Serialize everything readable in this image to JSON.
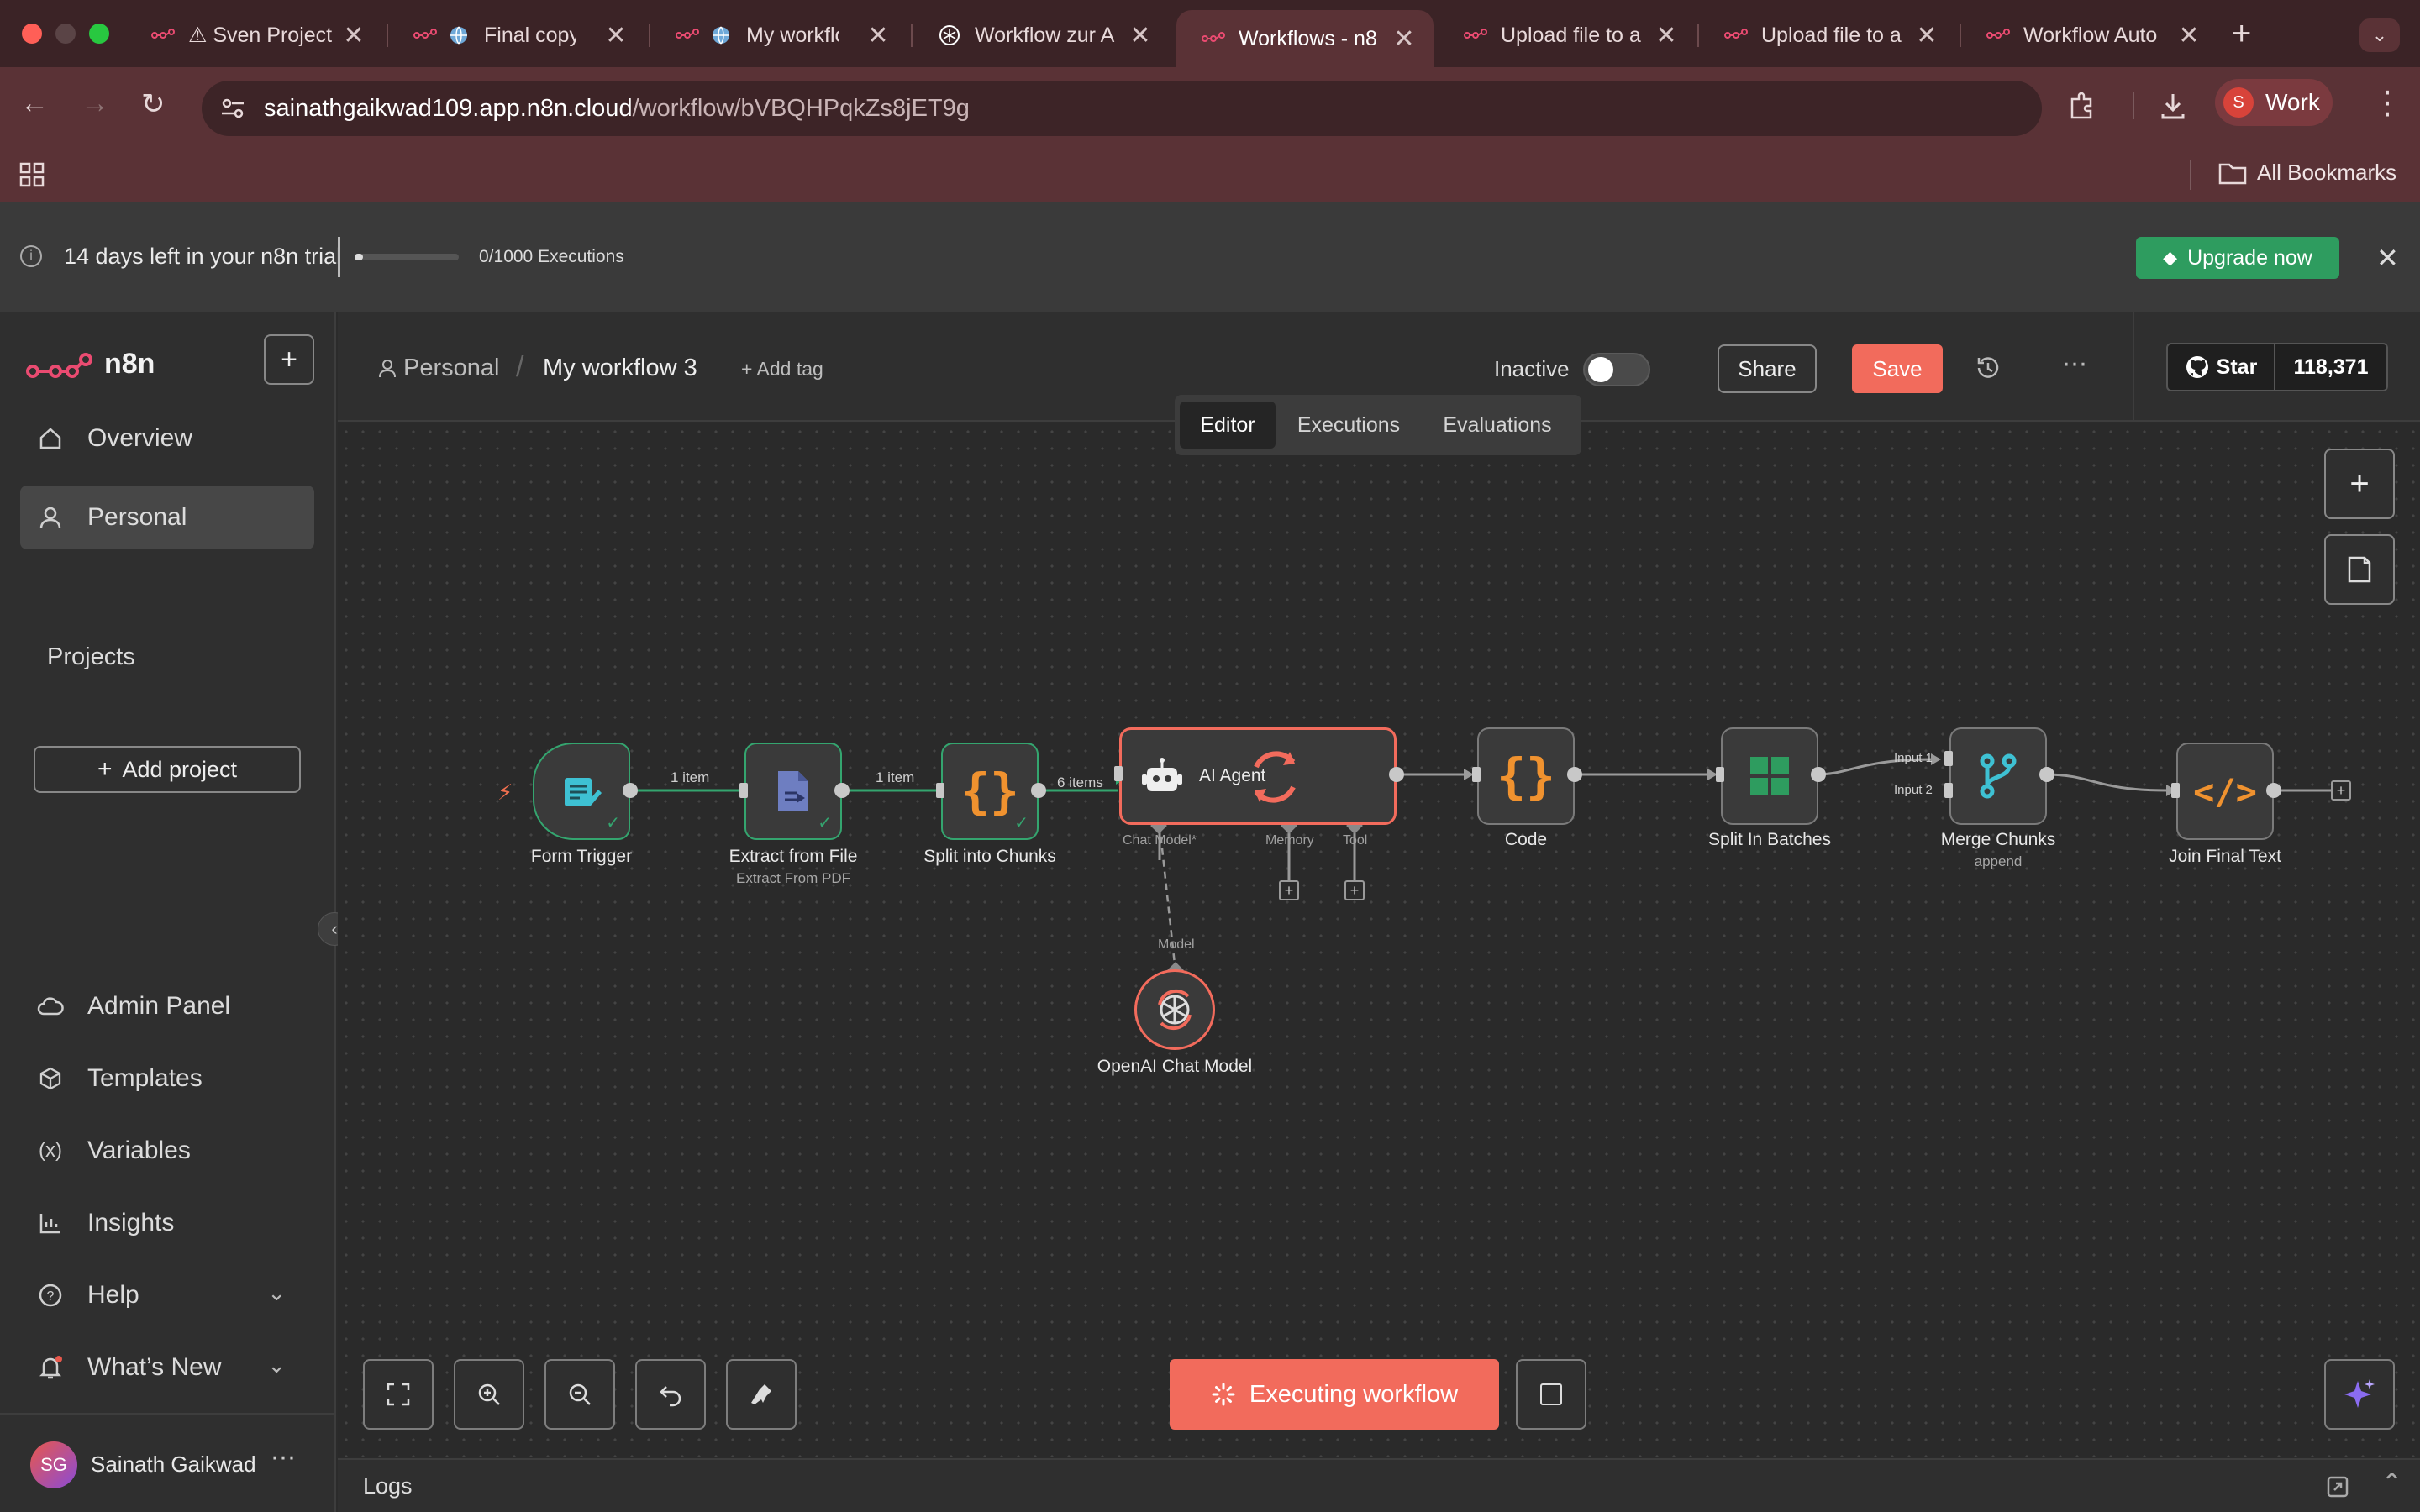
{
  "browser": {
    "tabs": [
      {
        "title": "⚠ Sven Project",
        "icon": "n8n-logo-icon"
      },
      {
        "title": "Final copy -",
        "icon": "globe-icon"
      },
      {
        "title": "My workflow",
        "icon": "globe-icon"
      },
      {
        "title": "Workflow zur A",
        "icon": "openai-icon"
      },
      {
        "title": "Workflows - n8",
        "icon": "n8n-logo-icon",
        "active": true
      },
      {
        "title": "Upload file to a",
        "icon": "n8n-logo-icon"
      },
      {
        "title": "Upload file to a",
        "icon": "n8n-logo-icon"
      },
      {
        "title": "Workflow Auto",
        "icon": "n8n-logo-icon"
      }
    ],
    "url_host": "sainathgaikwad109.app.n8n.cloud",
    "url_path": "/workflow/bVBQHPqkZs8jET9g",
    "profile_label": "Work",
    "profile_initial": "S",
    "bookmarks_label": "All Bookmarks"
  },
  "trial": {
    "text": "14 days left in your n8n trial",
    "executions": "0/1000 Executions",
    "progress_fraction": 0.0,
    "upgrade_label": "Upgrade now"
  },
  "sidebar": {
    "brand": "n8n",
    "items": [
      {
        "label": "Overview",
        "icon": "home-icon"
      },
      {
        "label": "Personal",
        "icon": "user-icon",
        "active": true
      }
    ],
    "projects_heading": "Projects",
    "add_project_label": "Add project",
    "bottom_items": [
      {
        "label": "Admin Panel",
        "icon": "cloud-icon"
      },
      {
        "label": "Templates",
        "icon": "templates-icon"
      },
      {
        "label": "Variables",
        "icon": "variables-icon"
      },
      {
        "label": "Insights",
        "icon": "chart-icon"
      },
      {
        "label": "Help",
        "icon": "help-icon"
      },
      {
        "label": "What’s New",
        "icon": "bell-icon"
      }
    ],
    "user_initials": "SG",
    "user_name": "Sainath Gaikwad"
  },
  "header": {
    "breadcrumb_project": "Personal",
    "workflow_name": "My workflow 3",
    "add_tag": "+ Add tag",
    "status_label": "Inactive",
    "share_label": "Share",
    "save_label": "Save",
    "github_star": "Star",
    "github_count": "118,371",
    "tabs": [
      "Editor",
      "Executions",
      "Evaluations"
    ],
    "active_tab": "Editor"
  },
  "workflow": {
    "nodes": [
      {
        "name": "Form Trigger",
        "subtitle": ""
      },
      {
        "name": "Extract from File",
        "subtitle": "Extract From PDF"
      },
      {
        "name": "Split into Chunks",
        "subtitle": ""
      },
      {
        "name": "AI Agent",
        "subtitle": ""
      },
      {
        "name": "Code",
        "subtitle": ""
      },
      {
        "name": "Split In Batches",
        "subtitle": ""
      },
      {
        "name": "Merge Chunks",
        "subtitle": "append"
      },
      {
        "name": "Join Final Text",
        "subtitle": ""
      },
      {
        "name": "OpenAI Chat Model",
        "subtitle": ""
      }
    ],
    "edge_labels": [
      "1 item",
      "1 item",
      "6 items"
    ],
    "agent_ports": [
      "Chat Model*",
      "Memory",
      "Tool"
    ],
    "model_port": "Model",
    "merge_inputs": [
      "Input 1",
      "Input 2"
    ]
  },
  "canvas": {
    "execute_label": "Executing workflow"
  },
  "logs": {
    "label": "Logs"
  }
}
